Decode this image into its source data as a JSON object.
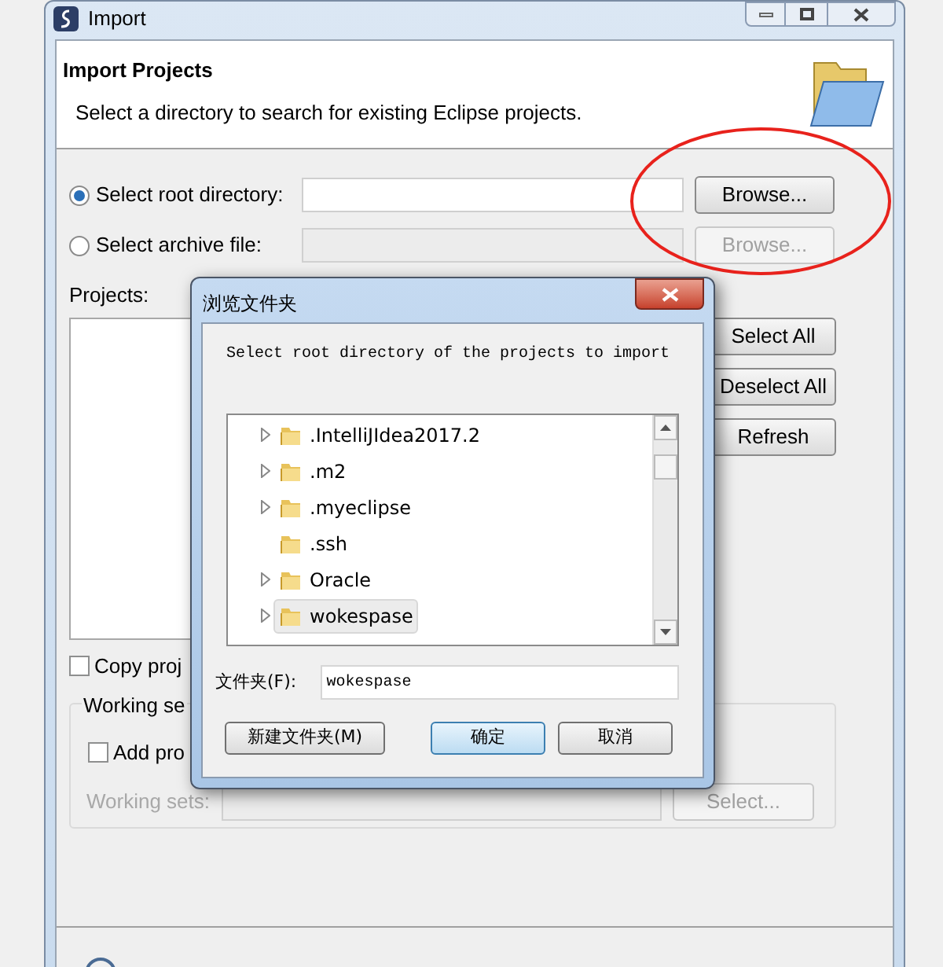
{
  "window": {
    "title": "Import"
  },
  "header": {
    "title": "Import Projects",
    "description": "Select a directory to search for existing Eclipse projects."
  },
  "source_options": [
    {
      "label": "Select root directory:",
      "selected": true,
      "browse": {
        "label": "Browse...",
        "disabled": false
      }
    },
    {
      "label": "Select archive file:",
      "selected": false,
      "browse": {
        "label": "Browse...",
        "disabled": true
      }
    }
  ],
  "projects": {
    "label": "Projects:",
    "buttons": [
      "Select All",
      "Deselect All",
      "Refresh"
    ]
  },
  "copy_checkbox": {
    "label": "Copy proj",
    "checked": false
  },
  "working_set": {
    "title": "Working se",
    "add_checkbox": {
      "label": "Add pro",
      "checked": false
    },
    "sets_label": {
      "label": "Working sets:",
      "disabled": true
    },
    "select_button": {
      "label": "Select...",
      "disabled": true
    }
  },
  "dialog": {
    "title": "浏览文件夹",
    "instruction": "Select root directory of the projects to import",
    "tree": [
      {
        "label": ".IntelliJIdea2017.2",
        "expandable": true,
        "selected": false
      },
      {
        "label": ".m2",
        "expandable": true,
        "selected": false
      },
      {
        "label": ".myeclipse",
        "expandable": true,
        "selected": false
      },
      {
        "label": ".ssh",
        "expandable": false,
        "selected": false
      },
      {
        "label": "Oracle",
        "expandable": true,
        "selected": false
      },
      {
        "label": "wokespase",
        "expandable": true,
        "selected": true
      }
    ],
    "folder_label": "文件夹(F):",
    "folder_value": "wokespase",
    "buttons": [
      {
        "label": "新建文件夹(M)",
        "default": false
      },
      {
        "label": "确定",
        "default": true
      },
      {
        "label": "取消",
        "default": false
      }
    ]
  }
}
